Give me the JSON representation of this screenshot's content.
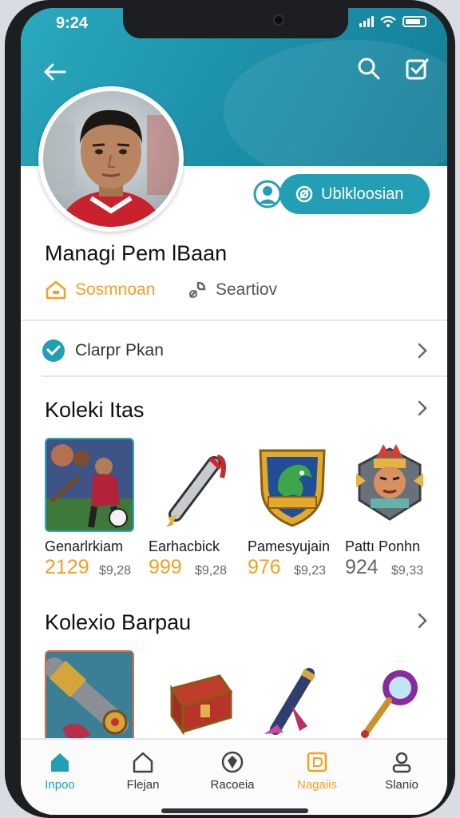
{
  "status_bar": {
    "time": "9:24"
  },
  "header": {
    "back_icon": "arrow-left-icon",
    "search_icon": "search-icon",
    "action_icon": "checkbox-icon"
  },
  "profile": {
    "action_button_label": "Ublkloosian",
    "name": "Managi  Pem lBaan",
    "meta_left": "Sosmnoan",
    "meta_right": "Seartiov",
    "accent": "#229fb5",
    "orange": "#f5a021"
  },
  "link_row": {
    "label": "Clarpr Pkan"
  },
  "section_one": {
    "title": "Koleki Itas",
    "items": [
      {
        "name": "Genarlrkiam",
        "price": "2129",
        "old_price": "$9,28"
      },
      {
        "name": "Earhacbick",
        "price": "999",
        "old_price": "$9,28"
      },
      {
        "name": "Pamesyujain",
        "price": "976",
        "old_price": "$9,23"
      },
      {
        "name": "Pattı Ponhn",
        "price": "924",
        "old_price": "$9,33"
      }
    ]
  },
  "section_two": {
    "title": "Kolexio Barpau"
  },
  "tabbar": {
    "tabs": [
      {
        "label": "Inpoo",
        "icon": "home-icon",
        "active": true
      },
      {
        "label": "Flejan",
        "icon": "home-outline-icon",
        "active": false
      },
      {
        "label": "Racoeia",
        "icon": "shield-icon",
        "active": false
      },
      {
        "label": "Nagaiis",
        "icon": "tag-icon",
        "active": false
      },
      {
        "label": "Slanio",
        "icon": "person-icon",
        "active": false
      }
    ]
  }
}
